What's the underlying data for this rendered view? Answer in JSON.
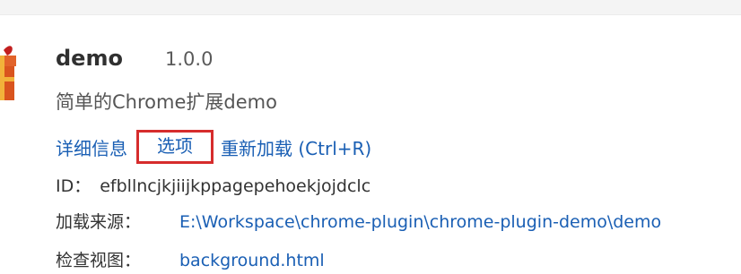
{
  "extension": {
    "name": "demo",
    "version": "1.0.0",
    "description": "简单的Chrome扩展demo"
  },
  "actions": {
    "details_label": "详细信息",
    "options_label": "选项",
    "reload_label": "重新加载 (Ctrl+R)"
  },
  "info": {
    "id_label": "ID：",
    "id_value": "efbllncjkjiijkppagepehoekjojdclc",
    "source_label": "加载来源：",
    "source_value": "E:\\Workspace\\chrome-plugin\\chrome-plugin-demo\\demo",
    "view_label": "检查视图：",
    "view_value": "background.html"
  },
  "colors": {
    "link": "#1a5fb4",
    "highlight_box": "#d62c2c",
    "icon_gift": "#d9541e",
    "icon_ribbon": "#c21f1f"
  },
  "icons": {
    "extension_icon": "gift-icon"
  }
}
